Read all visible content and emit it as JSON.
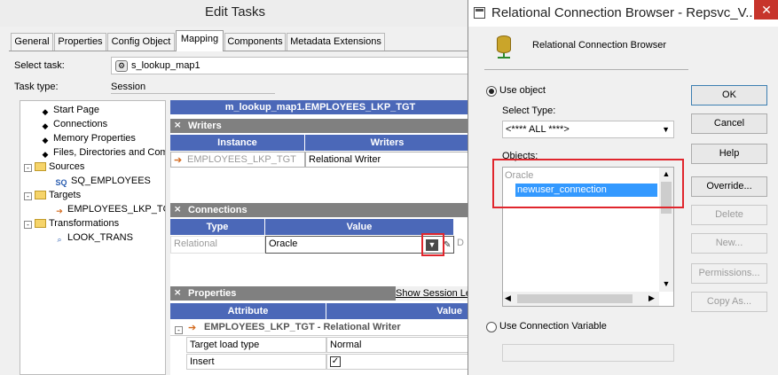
{
  "edit_tasks": {
    "title": "Edit Tasks",
    "tabs": [
      "General",
      "Properties",
      "Config Object",
      "Mapping",
      "Components",
      "Metadata Extensions"
    ],
    "active_tab": "Mapping",
    "select_task_label": "Select task:",
    "select_task_value": "s_lookup_map1",
    "task_type_label": "Task type:",
    "task_type_value": "Session",
    "tree": [
      {
        "label": "Start Page",
        "icon": "diamond-icon",
        "indent": 1
      },
      {
        "label": "Connections",
        "icon": "diamond-icon",
        "indent": 1
      },
      {
        "label": "Memory Properties",
        "icon": "diamond-icon",
        "indent": 1
      },
      {
        "label": "Files, Directories and Com",
        "icon": "diamond-icon",
        "indent": 1
      },
      {
        "label": "Sources",
        "icon": "folder-icon",
        "indent": 0,
        "expander": "-"
      },
      {
        "label": "SQ_EMPLOYEES",
        "icon": "sq-icon",
        "indent": 2
      },
      {
        "label": "Targets",
        "icon": "folder-icon",
        "indent": 0,
        "expander": "-"
      },
      {
        "label": "EMPLOYEES_LKP_TGT",
        "icon": "target-icon",
        "indent": 2
      },
      {
        "label": "Transformations",
        "icon": "folder-icon",
        "indent": 0,
        "expander": "-"
      },
      {
        "label": "LOOK_TRANS",
        "icon": "lookup-icon",
        "indent": 2
      }
    ],
    "mapping_header": "m_lookup_map1.EMPLOYEES_LKP_TGT",
    "writers_section": "Writers",
    "writers_columns": [
      "Instance",
      "Writers"
    ],
    "writers_row": {
      "instance": "EMPLOYEES_LKP_TGT",
      "writer": "Relational Writer"
    },
    "connections_section": "Connections",
    "connections_columns": [
      "Type",
      "Value"
    ],
    "connections_row": {
      "type": "Relational",
      "value": "Oracle",
      "extra": "D"
    },
    "properties_section": "Properties",
    "show_session_link": "Show Session Le",
    "properties_columns": [
      "Attribute",
      "Value"
    ],
    "properties_group": "EMPLOYEES_LKP_TGT - Relational Writer",
    "properties_rows": [
      {
        "attribute": "Target load type",
        "value": "Normal"
      },
      {
        "attribute": "Insert",
        "value": "✓"
      }
    ]
  },
  "dialog": {
    "title": "Relational Connection Browser - Repsvc_V...",
    "close_glyph": "✕",
    "header_label": "Relational Connection Browser",
    "use_object_label": "Use object",
    "use_object_selected": true,
    "select_type_label": "Select Type:",
    "select_type_value": "<**** ALL ****>",
    "objects_label": "Objects:",
    "objects_group": "Oracle",
    "objects_items": [
      "newuser_connection"
    ],
    "selected_object": "newuser_connection",
    "use_conn_var_label": "Use Connection Variable",
    "use_conn_var_selected": false,
    "buttons": {
      "ok": "OK",
      "cancel": "Cancel",
      "help": "Help",
      "override": "Override...",
      "delete": "Delete",
      "new": "New...",
      "permissions": "Permissions...",
      "copy_as": "Copy As..."
    }
  },
  "colors": {
    "header_blue": "#4b68b8",
    "section_gray": "#808080",
    "highlight_red": "#e0262d",
    "selection_blue": "#3399ff"
  }
}
